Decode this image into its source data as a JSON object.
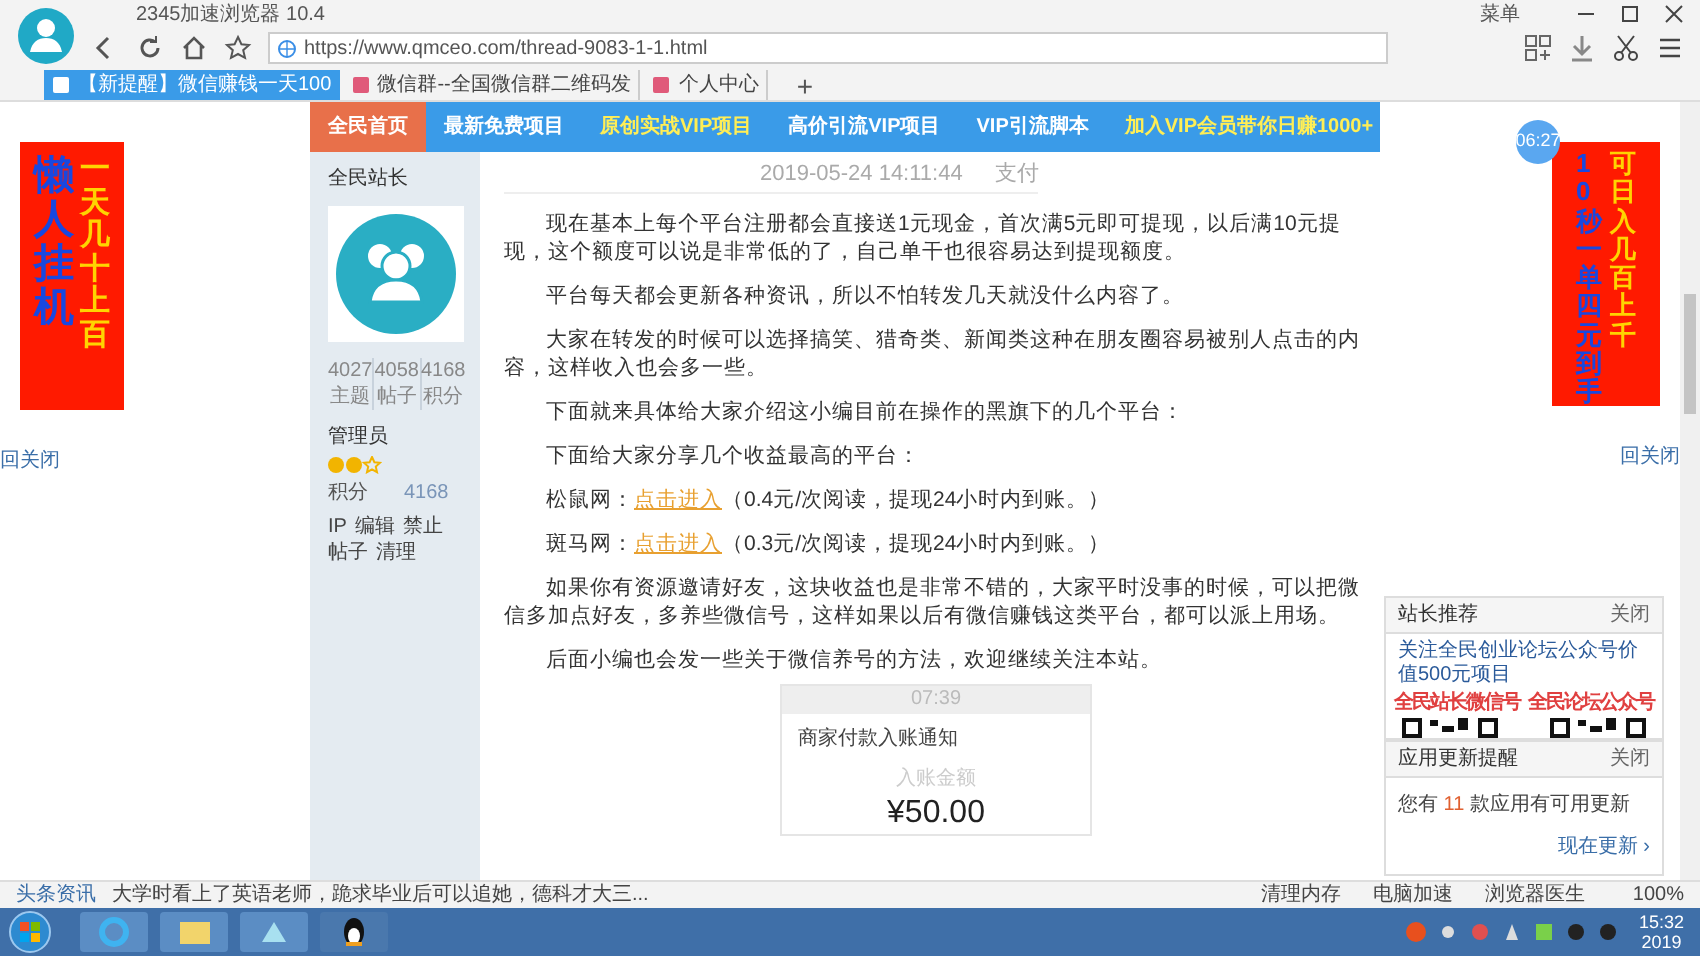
{
  "browser": {
    "title": "2345加速浏览器 10.4",
    "menu": "菜单",
    "address": "https://www.qmceo.com/thread-9083-1-1.html",
    "tabs": [
      {
        "label": "【新提醒】微信赚钱一天100",
        "selected": true
      },
      {
        "label": "微信群--全国微信群二维码发",
        "selected": false
      },
      {
        "label": "个人中心",
        "selected": false
      }
    ],
    "new_tab": "+"
  },
  "left_ad": {
    "main": "懒人挂机",
    "side": "一天几十上百",
    "close": "回关闭"
  },
  "nav": [
    {
      "label": "全民首页",
      "selected": true,
      "highlighted": false
    },
    {
      "label": "最新免费项目",
      "selected": false,
      "highlighted": false
    },
    {
      "label": "原创实战VIP项目",
      "selected": false,
      "highlighted": true
    },
    {
      "label": "高价引流VIP项目",
      "selected": false,
      "highlighted": false
    },
    {
      "label": "VIP引流脚本",
      "selected": false,
      "highlighted": false
    },
    {
      "label": "加入VIP会员带你日赚1000+",
      "selected": false,
      "highlighted": true
    }
  ],
  "profile": {
    "name": "全民站长",
    "stats": [
      {
        "value": "4027",
        "label": "主题"
      },
      {
        "value": "4058",
        "label": "帖子"
      },
      {
        "value": "4168",
        "label": "积分"
      }
    ],
    "group": "管理员",
    "points_label": "积分",
    "points": "4168",
    "actions": [
      "IP",
      "编辑",
      "禁止",
      "帖子",
      "清理"
    ]
  },
  "post": {
    "date": "2019-05-24 14:11:44",
    "meta": "支付",
    "paragraphs": [
      {
        "text": "现在基本上每个平台注册都会直接送1元现金，首次满5元即可提现，以后满10元提现，这个额度可以说是非常低的了，自己单干也很容易达到提现额度。"
      },
      {
        "text": "平台每天都会更新各种资讯，所以不怕转发几天就没什么内容了。"
      },
      {
        "text": "大家在转发的时候可以选择搞笑、猎奇类、新闻类这种在朋友圈容易被别人点击的内容，这样收入也会多一些。"
      },
      {
        "text": "下面就来具体给大家介绍这小编目前在操作的黑旗下的几个平台："
      },
      {
        "text": "下面给大家分享几个收益最高的平台："
      },
      {
        "text": "松鼠网：",
        "link": "点击进入",
        "after": "（0.4元/次阅读，提现24小时内到账。）"
      },
      {
        "text": "斑马网：",
        "link": "点击进入",
        "after": "（0.3元/次阅读，提现24小时内到账。）"
      },
      {
        "text": "如果你有资源邀请好友，这块收益也是非常不错的，大家平时没事的时候，可以把微信多加点好友，多养些微信号，这样如果以后有微信赚钱这类平台，都可以派上用场。"
      },
      {
        "text": "后面小编也会发一些关于微信养号的方法，欢迎继续关注本站。"
      }
    ],
    "screenshot": {
      "time": "07:39",
      "title": "商家付款入账通知",
      "amount_label": "入账金额",
      "amount": "¥50.00"
    }
  },
  "right": {
    "clock": "06:27",
    "ad_main": "10秒一单四元到手",
    "ad_side": "可日入几百上千",
    "close": "回关闭"
  },
  "widgets": [
    {
      "title": "站长推荐",
      "close": "关闭",
      "text": "关注全民创业论坛公众号价值500元项目",
      "qr_labels": [
        "全民站长微信号",
        "全民论坛公众号"
      ]
    },
    {
      "title": "应用更新提醒",
      "close": "关闭",
      "before": "您有",
      "count": "11",
      "after": "款应用有可用更新",
      "action": "现在更新 ›"
    }
  ],
  "status_bar": {
    "news_label": "头条资讯",
    "news": "大学时看上了英语老师，跪求毕业后可以追她，德科才大三...",
    "tools": [
      "清理内存",
      "电脑加速",
      "浏览器医生"
    ],
    "zoom": "100%"
  },
  "taskbar": {
    "time": "15:32",
    "year": "2019"
  }
}
